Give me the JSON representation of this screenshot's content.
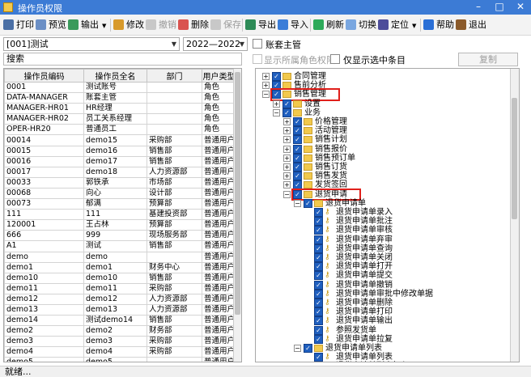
{
  "window": {
    "title": "操作员权限",
    "minimize": "–",
    "maximize": "□",
    "close": "✕"
  },
  "toolbar": {
    "print": "打印",
    "preview": "预览",
    "output": "输出",
    "modify": "修改",
    "undo": "撤销",
    "delete": "删除",
    "save": "保存",
    "export": "导出",
    "import": "导入",
    "refresh": "刷新",
    "switch": "切换",
    "locate": "定位",
    "help": "帮助",
    "exit": "退出"
  },
  "filters": {
    "account": "[001]测试",
    "year": "2022—2022",
    "account_admin": "账套主管",
    "show_role_rights": "显示所属角色权限",
    "show_selected_only": "仅显示选中条目",
    "copy": "复制",
    "search_value": "搜索"
  },
  "table": {
    "columns": [
      "操作员编码",
      "操作员全名",
      "部门",
      "用户类型"
    ],
    "rows": [
      [
        "0001",
        "测试账号",
        "",
        "角色"
      ],
      [
        "DATA-MANAGER",
        "账套主管",
        "",
        "角色"
      ],
      [
        "MANAGER-HR01",
        "HR经理",
        "",
        "角色"
      ],
      [
        "MANAGER-HR02",
        "员工关系经理",
        "",
        "角色"
      ],
      [
        "OPER-HR20",
        "普通员工",
        "",
        "角色"
      ],
      [
        "00014",
        "demo15",
        "采购部",
        "普通用户"
      ],
      [
        "00015",
        "demo16",
        "销售部",
        "普通用户"
      ],
      [
        "00016",
        "demo17",
        "销售部",
        "普通用户"
      ],
      [
        "00017",
        "demo18",
        "人力资源部",
        "普通用户"
      ],
      [
        "00033",
        "郭铁承",
        "市场部",
        "普通用户"
      ],
      [
        "00068",
        "向心",
        "设计部",
        "普通用户"
      ],
      [
        "00073",
        "郁满",
        "预算部",
        "普通用户"
      ],
      [
        "111",
        "111",
        "基建投资部",
        "普通用户"
      ],
      [
        "120001",
        "王占林",
        "预算部",
        "普通用户"
      ],
      [
        "666",
        "999",
        "现场服务部",
        "普通用户"
      ],
      [
        "A1",
        "测试",
        "销售部",
        "普通用户"
      ],
      [
        "demo",
        "demo",
        "",
        "普通用户"
      ],
      [
        "demo1",
        "demo1",
        "财务中心",
        "普通用户"
      ],
      [
        "demo10",
        "demo10",
        "销售部",
        "普通用户"
      ],
      [
        "demo11",
        "demo11",
        "采购部",
        "普通用户"
      ],
      [
        "demo12",
        "demo12",
        "人力资源部",
        "普通用户"
      ],
      [
        "demo13",
        "demo13",
        "人力资源部",
        "普通用户"
      ],
      [
        "demo14",
        "测试demo14",
        "销售部",
        "普通用户"
      ],
      [
        "demo2",
        "demo2",
        "财务部",
        "普通用户"
      ],
      [
        "demo3",
        "demo3",
        "采购部",
        "普通用户"
      ],
      [
        "demo4",
        "demo4",
        "采购部",
        "普通用户"
      ],
      [
        "demo5",
        "demo5",
        "",
        "普通用户"
      ]
    ]
  },
  "tree": {
    "nodes": [
      {
        "label": "合同管理",
        "level": 0,
        "expander": "+",
        "icon": "folder-icon",
        "highlight": false
      },
      {
        "label": "售前分析",
        "level": 0,
        "expander": "+",
        "icon": "folder-icon",
        "highlight": false
      },
      {
        "label": "销售管理",
        "level": 0,
        "expander": "−",
        "icon": "folder-icon",
        "highlight": true
      },
      {
        "label": "设置",
        "level": 1,
        "expander": "+",
        "icon": "folder-icon",
        "highlight": false
      },
      {
        "label": "业务",
        "level": 1,
        "expander": "−",
        "icon": "folder-icon",
        "highlight": false
      },
      {
        "label": "价格管理",
        "level": 2,
        "expander": "+",
        "icon": "folder-icon",
        "highlight": false
      },
      {
        "label": "活动管理",
        "level": 2,
        "expander": "+",
        "icon": "folder-icon",
        "highlight": false
      },
      {
        "label": "销售计划",
        "level": 2,
        "expander": "+",
        "icon": "folder-icon",
        "highlight": false
      },
      {
        "label": "销售报价",
        "level": 2,
        "expander": "+",
        "icon": "folder-icon",
        "highlight": false
      },
      {
        "label": "销售预订单",
        "level": 2,
        "expander": "+",
        "icon": "folder-icon",
        "highlight": false
      },
      {
        "label": "销售订货",
        "level": 2,
        "expander": "+",
        "icon": "folder-icon",
        "highlight": false
      },
      {
        "label": "销售发货",
        "level": 2,
        "expander": "+",
        "icon": "folder-icon",
        "highlight": false
      },
      {
        "label": "发货签回",
        "level": 2,
        "expander": "+",
        "icon": "folder-icon",
        "highlight": false
      },
      {
        "label": "退货申请",
        "level": 2,
        "expander": "−",
        "icon": "folder-icon",
        "highlight": true
      },
      {
        "label": "退货申请单",
        "level": 3,
        "expander": "−",
        "icon": "folder-icon",
        "highlight": false
      },
      {
        "label": "退货申请单录入",
        "level": 4,
        "expander": "",
        "icon": "key-icon",
        "highlight": false
      },
      {
        "label": "退货申请单批注",
        "level": 4,
        "expander": "",
        "icon": "key-icon",
        "highlight": false
      },
      {
        "label": "退货申请单审核",
        "level": 4,
        "expander": "",
        "icon": "key-icon",
        "highlight": false
      },
      {
        "label": "退货申请单弃审",
        "level": 4,
        "expander": "",
        "icon": "key-icon",
        "highlight": false
      },
      {
        "label": "退货申请单查询",
        "level": 4,
        "expander": "",
        "icon": "key-icon",
        "highlight": false
      },
      {
        "label": "退货申请单关闭",
        "level": 4,
        "expander": "",
        "icon": "key-icon",
        "highlight": false
      },
      {
        "label": "退货申请单打开",
        "level": 4,
        "expander": "",
        "icon": "key-icon",
        "highlight": false
      },
      {
        "label": "退货申请单提交",
        "level": 4,
        "expander": "",
        "icon": "key-icon",
        "highlight": false
      },
      {
        "label": "退货申请单撤销",
        "level": 4,
        "expander": "",
        "icon": "key-icon",
        "highlight": false
      },
      {
        "label": "退货申请单审批中修改单据",
        "level": 4,
        "expander": "",
        "icon": "key-icon",
        "highlight": false
      },
      {
        "label": "退货申请单删除",
        "level": 4,
        "expander": "",
        "icon": "key-icon",
        "highlight": false
      },
      {
        "label": "退货申请单打印",
        "level": 4,
        "expander": "",
        "icon": "key-icon",
        "highlight": false
      },
      {
        "label": "退货申请单输出",
        "level": 4,
        "expander": "",
        "icon": "key-icon",
        "highlight": false
      },
      {
        "label": "参照发货单",
        "level": 4,
        "expander": "",
        "icon": "key-icon",
        "highlight": false
      },
      {
        "label": "退货申请单拉复",
        "level": 4,
        "expander": "",
        "icon": "key-icon",
        "highlight": false
      },
      {
        "label": "退货申请单列表",
        "level": 3,
        "expander": "−",
        "icon": "folder-icon",
        "highlight": false
      },
      {
        "label": "退货申请单列表",
        "level": 4,
        "expander": "",
        "icon": "key-icon",
        "highlight": false
      },
      {
        "label": "退货申请单列表打印",
        "level": 4,
        "expander": "",
        "icon": "key-icon",
        "highlight": false
      }
    ]
  },
  "status": {
    "text": "就绪..."
  }
}
